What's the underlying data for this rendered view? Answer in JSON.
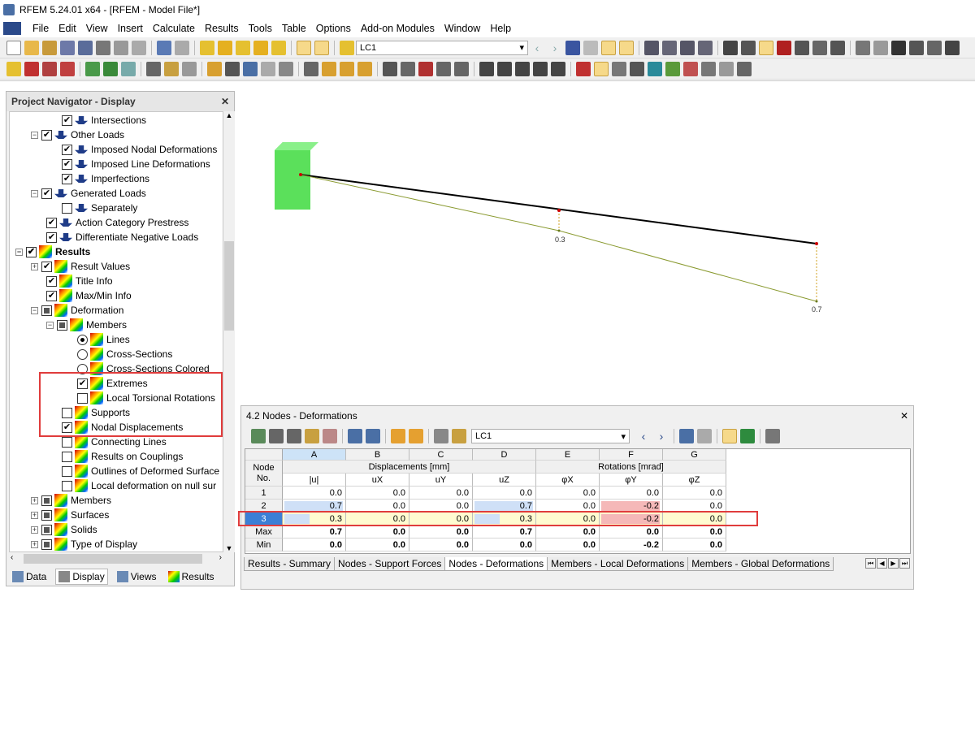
{
  "window": {
    "title": "RFEM 5.24.01 x64 - [RFEM - Model File*]"
  },
  "menu": [
    "File",
    "Edit",
    "View",
    "Insert",
    "Calculate",
    "Results",
    "Tools",
    "Table",
    "Options",
    "Add-on Modules",
    "Window",
    "Help"
  ],
  "toolbar": {
    "load_case": "LC1"
  },
  "navigator": {
    "title": "Project Navigator - Display",
    "items": [
      {
        "label": "Intersections"
      },
      {
        "label": "Other Loads"
      },
      {
        "label": "Imposed Nodal Deformations"
      },
      {
        "label": "Imposed Line Deformations"
      },
      {
        "label": "Imperfections"
      },
      {
        "label": "Generated Loads"
      },
      {
        "label": "Separately"
      },
      {
        "label": "Action Category Prestress"
      },
      {
        "label": "Differentiate Negative Loads"
      },
      {
        "label": "Results"
      },
      {
        "label": "Result Values"
      },
      {
        "label": "Title Info"
      },
      {
        "label": "Max/Min Info"
      },
      {
        "label": "Deformation"
      },
      {
        "label": "Members"
      },
      {
        "label": "Lines"
      },
      {
        "label": "Cross-Sections"
      },
      {
        "label": "Cross-Sections Colored"
      },
      {
        "label": "Extremes"
      },
      {
        "label": "Local Torsional Rotations"
      },
      {
        "label": "Supports"
      },
      {
        "label": "Nodal Displacements"
      },
      {
        "label": "Connecting Lines"
      },
      {
        "label": "Results on Couplings"
      },
      {
        "label": "Outlines of Deformed Surface"
      },
      {
        "label": "Local deformation on null sur"
      },
      {
        "label": "Members"
      },
      {
        "label": "Surfaces"
      },
      {
        "label": "Solids"
      },
      {
        "label": "Type of Display"
      }
    ],
    "tabs": [
      "Data",
      "Display",
      "Views",
      "Results"
    ]
  },
  "view": {
    "label_mid": "0.3",
    "label_end": "0.7"
  },
  "table": {
    "title": "4.2 Nodes - Deformations",
    "load_case": "LC1",
    "col_letters": [
      "A",
      "B",
      "C",
      "D",
      "E",
      "F",
      "G"
    ],
    "node_header": [
      "Node",
      "No."
    ],
    "group_displacements": "Displacements [mm]",
    "group_rotations": "Rotations [mrad]",
    "sub_headers": [
      "|u|",
      "uX",
      "uY",
      "uZ",
      "φX",
      "φY",
      "φZ"
    ],
    "rows": [
      {
        "no": "1",
        "vals": [
          "0.0",
          "0.0",
          "0.0",
          "0.0",
          "0.0",
          "0.0",
          "0.0"
        ]
      },
      {
        "no": "2",
        "vals": [
          "0.7",
          "0.0",
          "0.0",
          "0.7",
          "0.0",
          "-0.2",
          "0.0"
        ]
      },
      {
        "no": "3",
        "vals": [
          "0.3",
          "0.0",
          "0.0",
          "0.3",
          "0.0",
          "-0.2",
          "0.0"
        ]
      },
      {
        "no": "Max",
        "vals": [
          "0.7",
          "0.0",
          "0.0",
          "0.7",
          "0.0",
          "0.0",
          "0.0"
        ]
      },
      {
        "no": "Min",
        "vals": [
          "0.0",
          "0.0",
          "0.0",
          "0.0",
          "0.0",
          "-0.2",
          "0.0"
        ]
      }
    ],
    "tabs": [
      "Results - Summary",
      "Nodes - Support Forces",
      "Nodes - Deformations",
      "Members - Local Deformations",
      "Members - Global Deformations"
    ]
  }
}
